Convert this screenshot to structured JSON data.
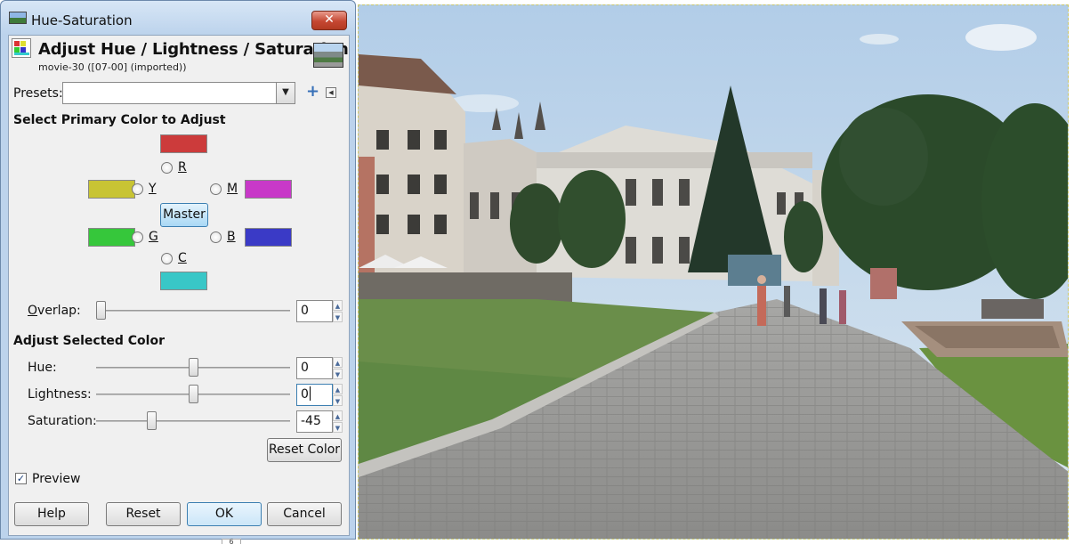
{
  "window": {
    "title": "Hue-Saturation",
    "close_glyph": "✕"
  },
  "header": {
    "title": "Adjust Hue / Lightness / Saturation",
    "subtitle": "movie-30 ([07-00] (imported))"
  },
  "presets": {
    "label": "Presets:",
    "value": ""
  },
  "primary": {
    "section": "Select Primary Color to Adjust",
    "colors": {
      "r": {
        "label": "R",
        "color": "#cc3b3b"
      },
      "y": {
        "label": "Y",
        "color": "#c8c434"
      },
      "g": {
        "label": "G",
        "color": "#36c73b"
      },
      "c": {
        "label": "C",
        "color": "#39c7c7"
      },
      "b": {
        "label": "B",
        "color": "#3a3ac6"
      },
      "m": {
        "label": "M",
        "color": "#c839c8"
      }
    },
    "master_label": "Master",
    "selected": "Master"
  },
  "overlap": {
    "label": "Overlap:",
    "value": "0",
    "fraction": 0.0
  },
  "adjust": {
    "section": "Adjust Selected Color",
    "hue": {
      "label": "Hue:",
      "value": "0",
      "min": -180,
      "max": 180
    },
    "lightness": {
      "label": "Lightness:",
      "value": "0",
      "min": -100,
      "max": 100
    },
    "saturation": {
      "label": "Saturation:",
      "value": "-45",
      "min": -100,
      "max": 100
    }
  },
  "buttons": {
    "reset_color": "Reset Color",
    "help": "Help",
    "reset": "Reset",
    "ok": "OK",
    "cancel": "Cancel"
  },
  "preview": {
    "label": "Preview",
    "checked": true
  },
  "below_tab": "6"
}
